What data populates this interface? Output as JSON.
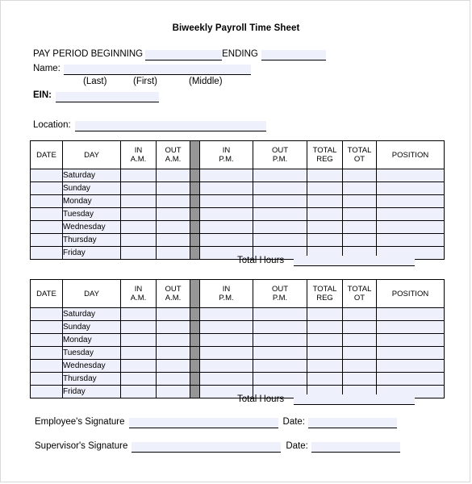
{
  "document": {
    "title": "Biweekly Payroll Time Sheet"
  },
  "header": {
    "pay_period_label": "PAY PERIOD BEGINNING",
    "ending_label": "ENDING",
    "beginning_value": "",
    "ending_value": "",
    "name_label": "Name:",
    "name_value": "",
    "name_parts": {
      "last": "(Last)",
      "first": "(First)",
      "middle": "(Middle)"
    },
    "ein_label": "EIN:",
    "ein_value": "",
    "location_label": "Location:",
    "location_value": ""
  },
  "table": {
    "columns": [
      {
        "key": "date",
        "line1": "DATE",
        "line2": ""
      },
      {
        "key": "day",
        "line1": "DAY",
        "line2": ""
      },
      {
        "key": "in_am",
        "line1": "IN",
        "line2": "A.M."
      },
      {
        "key": "out_am",
        "line1": "OUT",
        "line2": "A.M."
      },
      {
        "key": "spacer",
        "line1": "",
        "line2": ""
      },
      {
        "key": "in_pm",
        "line1": "IN",
        "line2": "P.M."
      },
      {
        "key": "out_pm",
        "line1": "OUT",
        "line2": "P.M."
      },
      {
        "key": "total_reg",
        "line1": "TOTAL",
        "line2": "REG"
      },
      {
        "key": "total_ot",
        "line1": "TOTAL",
        "line2": "OT"
      },
      {
        "key": "position",
        "line1": "POSITION",
        "line2": ""
      }
    ],
    "days": [
      "Saturday",
      "Sunday",
      "Monday",
      "Tuesday",
      "Wednesday",
      "Thursday",
      "Friday"
    ],
    "total_hours_label": "Total Hours"
  },
  "week1": {
    "total_hours_value": "",
    "rows": [
      {
        "day": "Saturday",
        "date": "",
        "in_am": "",
        "out_am": "",
        "in_pm": "",
        "out_pm": "",
        "total_reg": "",
        "total_ot": "",
        "position": ""
      },
      {
        "day": "Sunday",
        "date": "",
        "in_am": "",
        "out_am": "",
        "in_pm": "",
        "out_pm": "",
        "total_reg": "",
        "total_ot": "",
        "position": ""
      },
      {
        "day": "Monday",
        "date": "",
        "in_am": "",
        "out_am": "",
        "in_pm": "",
        "out_pm": "",
        "total_reg": "",
        "total_ot": "",
        "position": ""
      },
      {
        "day": "Tuesday",
        "date": "",
        "in_am": "",
        "out_am": "",
        "in_pm": "",
        "out_pm": "",
        "total_reg": "",
        "total_ot": "",
        "position": ""
      },
      {
        "day": "Wednesday",
        "date": "",
        "in_am": "",
        "out_am": "",
        "in_pm": "",
        "out_pm": "",
        "total_reg": "",
        "total_ot": "",
        "position": ""
      },
      {
        "day": "Thursday",
        "date": "",
        "in_am": "",
        "out_am": "",
        "in_pm": "",
        "out_pm": "",
        "total_reg": "",
        "total_ot": "",
        "position": ""
      },
      {
        "day": "Friday",
        "date": "",
        "in_am": "",
        "out_am": "",
        "in_pm": "",
        "out_pm": "",
        "total_reg": "",
        "total_ot": "",
        "position": ""
      }
    ]
  },
  "week2": {
    "total_hours_value": "",
    "rows": [
      {
        "day": "Saturday",
        "date": "",
        "in_am": "",
        "out_am": "",
        "in_pm": "",
        "out_pm": "",
        "total_reg": "",
        "total_ot": "",
        "position": ""
      },
      {
        "day": "Sunday",
        "date": "",
        "in_am": "",
        "out_am": "",
        "in_pm": "",
        "out_pm": "",
        "total_reg": "",
        "total_ot": "",
        "position": ""
      },
      {
        "day": "Monday",
        "date": "",
        "in_am": "",
        "out_am": "",
        "in_pm": "",
        "out_pm": "",
        "total_reg": "",
        "total_ot": "",
        "position": ""
      },
      {
        "day": "Tuesday",
        "date": "",
        "in_am": "",
        "out_am": "",
        "in_pm": "",
        "out_pm": "",
        "total_reg": "",
        "total_ot": "",
        "position": ""
      },
      {
        "day": "Wednesday",
        "date": "",
        "in_am": "",
        "out_am": "",
        "in_pm": "",
        "out_pm": "",
        "total_reg": "",
        "total_ot": "",
        "position": ""
      },
      {
        "day": "Thursday",
        "date": "",
        "in_am": "",
        "out_am": "",
        "in_pm": "",
        "out_pm": "",
        "total_reg": "",
        "total_ot": "",
        "position": ""
      },
      {
        "day": "Friday",
        "date": "",
        "in_am": "",
        "out_am": "",
        "in_pm": "",
        "out_pm": "",
        "total_reg": "",
        "total_ot": "",
        "position": ""
      }
    ]
  },
  "signatures": {
    "employee_label": "Employee's Signature",
    "employee_value": "",
    "employee_date_label": "Date:",
    "employee_date_value": "",
    "supervisor_label": "Supervisor's Signature",
    "supervisor_value": "",
    "supervisor_date_label": "Date:",
    "supervisor_date_value": ""
  },
  "colors": {
    "field_fill": "#eef0fb",
    "spacer_column": "#969696",
    "rule": "#000000",
    "page_border": "#d9d9d9"
  }
}
